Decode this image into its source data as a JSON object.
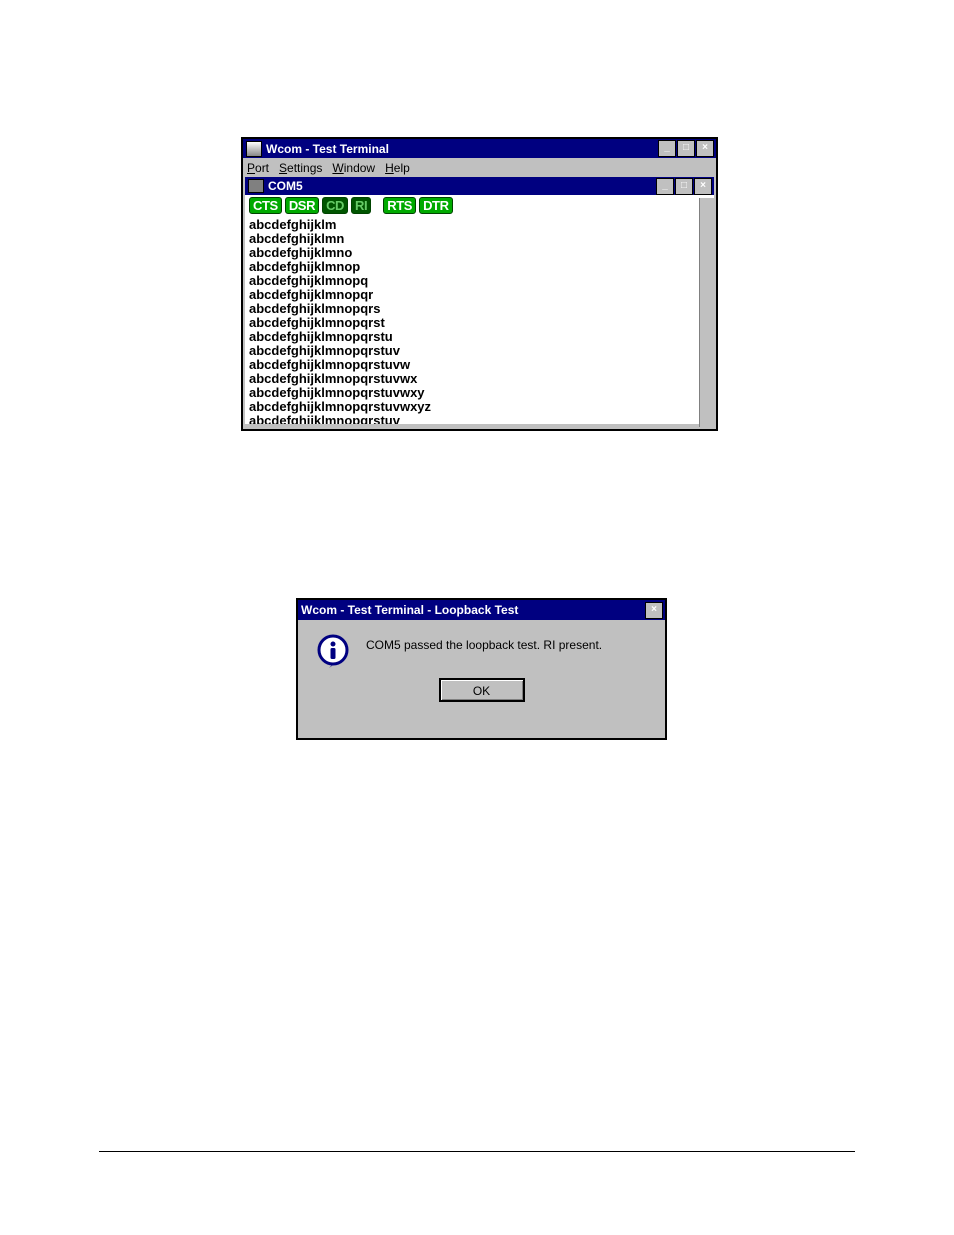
{
  "main_window": {
    "title": "Wcom - Test Terminal",
    "menu": [
      "Port",
      "Settings",
      "Window",
      "Help"
    ],
    "port_child": {
      "title": "COM5",
      "lamps": [
        {
          "label": "CTS",
          "on": true
        },
        {
          "label": "DSR",
          "on": true
        },
        {
          "label": "CD",
          "on": false
        },
        {
          "label": "RI",
          "on": false
        },
        {
          "label": "RTS",
          "on": true
        },
        {
          "label": "DTR",
          "on": true
        }
      ],
      "output_lines": [
        "abcdefghijklm",
        "abcdefghijklmn",
        "abcdefghijklmno",
        "abcdefghijklmnop",
        "abcdefghijklmnopq",
        "abcdefghijklmnopqr",
        "abcdefghijklmnopqrs",
        "abcdefghijklmnopqrst",
        "abcdefghijklmnopqrstu",
        "abcdefghijklmnopqrstuv",
        "abcdefghijklmnopqrstuvw",
        "abcdefghijklmnopqrstuvwx",
        "abcdefghijklmnopqrstuvwxy",
        "abcdefghijklmnopqrstuvwxyz",
        "abcdefghijklmnopqrstuv_"
      ]
    }
  },
  "dialog": {
    "title": "Wcom - Test Terminal - Loopback Test",
    "message": "COM5 passed the loopback test. RI present.",
    "ok_label": "OK"
  },
  "sysbtn": {
    "min": "_",
    "max": "□",
    "close": "×"
  }
}
